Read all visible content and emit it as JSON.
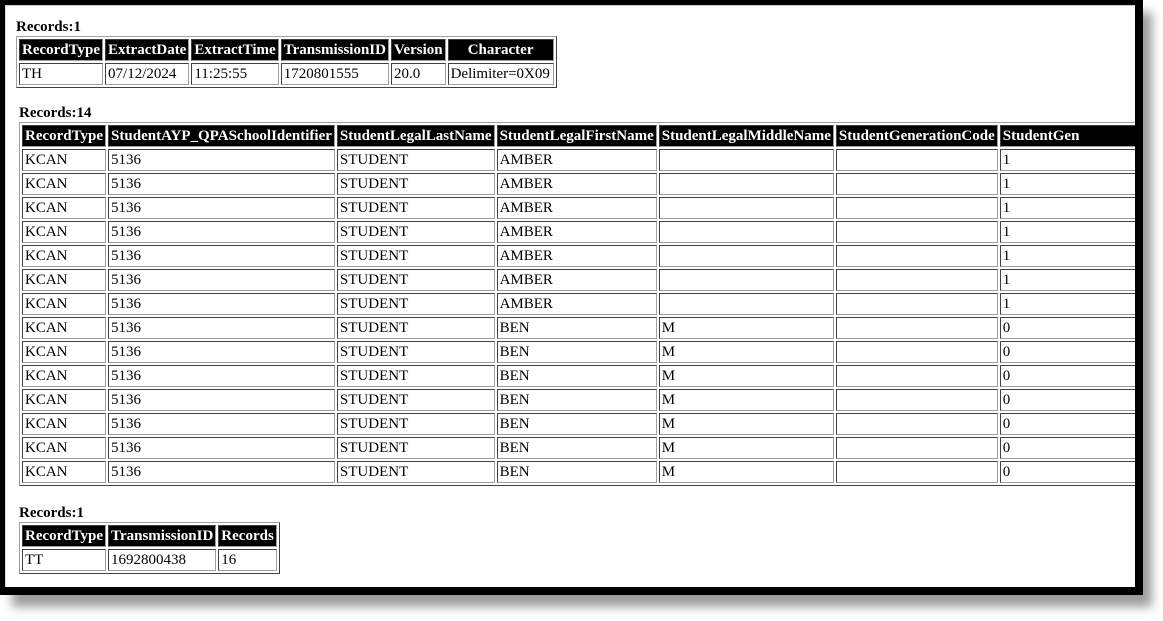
{
  "header_section": {
    "label": "Records:1",
    "columns": [
      "RecordType",
      "ExtractDate",
      "ExtractTime",
      "TransmissionID",
      "Version",
      "Character"
    ],
    "rows": [
      [
        "TH",
        "07/12/2024",
        "11:25:55",
        "1720801555",
        "20.0",
        "Delimiter=0X09"
      ]
    ]
  },
  "detail_section": {
    "label": "Records:14",
    "columns": [
      "RecordType",
      "StudentAYP_QPASchoolIdentifier",
      "StudentLegalLastName",
      "StudentLegalFirstName",
      "StudentLegalMiddleName",
      "StudentGenerationCode",
      "StudentGen"
    ],
    "rows": [
      [
        "KCAN",
        "5136",
        "STUDENT",
        "AMBER",
        "",
        "",
        "1"
      ],
      [
        "KCAN",
        "5136",
        "STUDENT",
        "AMBER",
        "",
        "",
        "1"
      ],
      [
        "KCAN",
        "5136",
        "STUDENT",
        "AMBER",
        "",
        "",
        "1"
      ],
      [
        "KCAN",
        "5136",
        "STUDENT",
        "AMBER",
        "",
        "",
        "1"
      ],
      [
        "KCAN",
        "5136",
        "STUDENT",
        "AMBER",
        "",
        "",
        "1"
      ],
      [
        "KCAN",
        "5136",
        "STUDENT",
        "AMBER",
        "",
        "",
        "1"
      ],
      [
        "KCAN",
        "5136",
        "STUDENT",
        "AMBER",
        "",
        "",
        "1"
      ],
      [
        "KCAN",
        "5136",
        "STUDENT",
        "BEN",
        "M",
        "",
        "0"
      ],
      [
        "KCAN",
        "5136",
        "STUDENT",
        "BEN",
        "M",
        "",
        "0"
      ],
      [
        "KCAN",
        "5136",
        "STUDENT",
        "BEN",
        "M",
        "",
        "0"
      ],
      [
        "KCAN",
        "5136",
        "STUDENT",
        "BEN",
        "M",
        "",
        "0"
      ],
      [
        "KCAN",
        "5136",
        "STUDENT",
        "BEN",
        "M",
        "",
        "0"
      ],
      [
        "KCAN",
        "5136",
        "STUDENT",
        "BEN",
        "M",
        "",
        "0"
      ],
      [
        "KCAN",
        "5136",
        "STUDENT",
        "BEN",
        "M",
        "",
        "0"
      ]
    ]
  },
  "trailer_section": {
    "label": "Records:1",
    "columns": [
      "RecordType",
      "TransmissionID",
      "Records"
    ],
    "rows": [
      [
        "TT",
        "1692800438",
        "16"
      ]
    ]
  },
  "colors": {
    "header_bg": "#000000",
    "header_text": "#ffffff",
    "frame": "#000000"
  }
}
